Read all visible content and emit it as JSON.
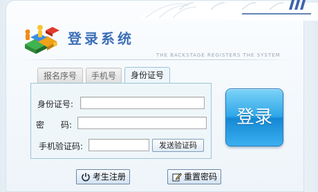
{
  "header": {
    "title": "登录系统",
    "subtitle": "THE BACKSTAGE REGISTERS THE SYSTEM"
  },
  "tabs": [
    {
      "label": "报名序号",
      "active": false
    },
    {
      "label": "手机号",
      "active": false
    },
    {
      "label": "身份证号",
      "active": true
    }
  ],
  "form": {
    "id_label": "身份证号:",
    "id_value": "",
    "password_label": "密　　码:",
    "password_value": "",
    "sms_label": "手机验证码:",
    "sms_value": "",
    "send_code_label": "发送验证码"
  },
  "login_button": "登录",
  "footer": {
    "register_label": "考生注册",
    "reset_label": "重置密码"
  },
  "colors": {
    "accent": "#2ea6e8",
    "title": "#3b6fb8",
    "form_bg": "#eef6fa",
    "form_border": "#9cc3d6"
  },
  "icons": {
    "register": "power-icon",
    "reset": "edit-icon",
    "logo": "cube-people-logo"
  }
}
